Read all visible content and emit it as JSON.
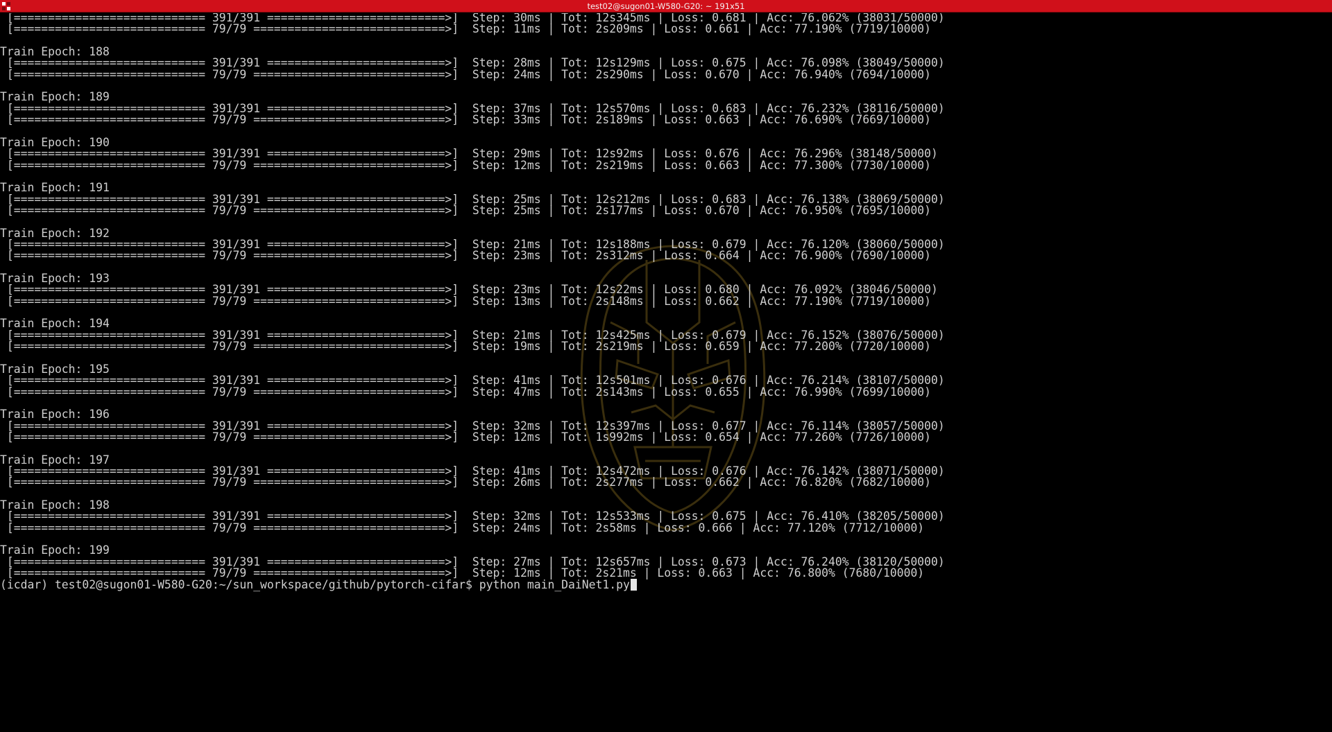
{
  "window": {
    "title": "test02@sugon01-W580-G20: ~ 191x51"
  },
  "terminal": {
    "fg_color": "#cfcfcf",
    "bg_color": "#000000",
    "titlebar_color": "#d0101a",
    "watermark_icon": "iron-man-helmet-icon",
    "lines": [
      " [============================ 391/391 ==========================>]  Step: 30ms | Tot: 12s345ms | Loss: 0.681 | Acc: 76.062% (38031/50000)",
      " [============================ 79/79 ============================>]  Step: 11ms | Tot: 2s209ms | Loss: 0.661 | Acc: 77.190% (7719/10000)",
      "",
      "Train Epoch: 188",
      " [============================ 391/391 ==========================>]  Step: 28ms | Tot: 12s129ms | Loss: 0.675 | Acc: 76.098% (38049/50000)",
      " [============================ 79/79 ============================>]  Step: 24ms | Tot: 2s290ms | Loss: 0.670 | Acc: 76.940% (7694/10000)",
      "",
      "Train Epoch: 189",
      " [============================ 391/391 ==========================>]  Step: 37ms | Tot: 12s570ms | Loss: 0.683 | Acc: 76.232% (38116/50000)",
      " [============================ 79/79 ============================>]  Step: 33ms | Tot: 2s189ms | Loss: 0.663 | Acc: 76.690% (7669/10000)",
      "",
      "Train Epoch: 190",
      " [============================ 391/391 ==========================>]  Step: 29ms | Tot: 12s92ms | Loss: 0.676 | Acc: 76.296% (38148/50000)",
      " [============================ 79/79 ============================>]  Step: 12ms | Tot: 2s219ms | Loss: 0.663 | Acc: 77.300% (7730/10000)",
      "",
      "Train Epoch: 191",
      " [============================ 391/391 ==========================>]  Step: 25ms | Tot: 12s212ms | Loss: 0.683 | Acc: 76.138% (38069/50000)",
      " [============================ 79/79 ============================>]  Step: 25ms | Tot: 2s177ms | Loss: 0.670 | Acc: 76.950% (7695/10000)",
      "",
      "Train Epoch: 192",
      " [============================ 391/391 ==========================>]  Step: 21ms | Tot: 12s188ms | Loss: 0.679 | Acc: 76.120% (38060/50000)",
      " [============================ 79/79 ============================>]  Step: 23ms | Tot: 2s312ms | Loss: 0.664 | Acc: 76.900% (7690/10000)",
      "",
      "Train Epoch: 193",
      " [============================ 391/391 ==========================>]  Step: 23ms | Tot: 12s22ms | Loss: 0.680 | Acc: 76.092% (38046/50000)",
      " [============================ 79/79 ============================>]  Step: 13ms | Tot: 2s148ms | Loss: 0.662 | Acc: 77.190% (7719/10000)",
      "",
      "Train Epoch: 194",
      " [============================ 391/391 ==========================>]  Step: 21ms | Tot: 12s425ms | Loss: 0.679 | Acc: 76.152% (38076/50000)",
      " [============================ 79/79 ============================>]  Step: 19ms | Tot: 2s219ms | Loss: 0.659 | Acc: 77.200% (7720/10000)",
      "",
      "Train Epoch: 195",
      " [============================ 391/391 ==========================>]  Step: 41ms | Tot: 12s501ms | Loss: 0.676 | Acc: 76.214% (38107/50000)",
      " [============================ 79/79 ============================>]  Step: 47ms | Tot: 2s143ms | Loss: 0.655 | Acc: 76.990% (7699/10000)",
      "",
      "Train Epoch: 196",
      " [============================ 391/391 ==========================>]  Step: 32ms | Tot: 12s397ms | Loss: 0.677 | Acc: 76.114% (38057/50000)",
      " [============================ 79/79 ============================>]  Step: 12ms | Tot: 1s992ms | Loss: 0.654 | Acc: 77.260% (7726/10000)",
      "",
      "Train Epoch: 197",
      " [============================ 391/391 ==========================>]  Step: 41ms | Tot: 12s472ms | Loss: 0.676 | Acc: 76.142% (38071/50000)",
      " [============================ 79/79 ============================>]  Step: 26ms | Tot: 2s277ms | Loss: 0.662 | Acc: 76.820% (7682/10000)",
      "",
      "Train Epoch: 198",
      " [============================ 391/391 ==========================>]  Step: 32ms | Tot: 12s533ms | Loss: 0.675 | Acc: 76.410% (38205/50000)",
      " [============================ 79/79 ============================>]  Step: 24ms | Tot: 2s58ms | Loss: 0.666 | Acc: 77.120% (7712/10000)",
      "",
      "Train Epoch: 199",
      " [============================ 391/391 ==========================>]  Step: 27ms | Tot: 12s657ms | Loss: 0.673 | Acc: 76.240% (38120/50000)",
      " [============================ 79/79 ============================>]  Step: 12ms | Tot: 2s21ms | Loss: 0.663 | Acc: 76.800% (7680/10000)"
    ],
    "prompt": "(icdar) test02@sugon01-W580-G20:~/sun_workspace/github/pytorch-cifar$ ",
    "command": "python main_DaiNet1.py"
  }
}
